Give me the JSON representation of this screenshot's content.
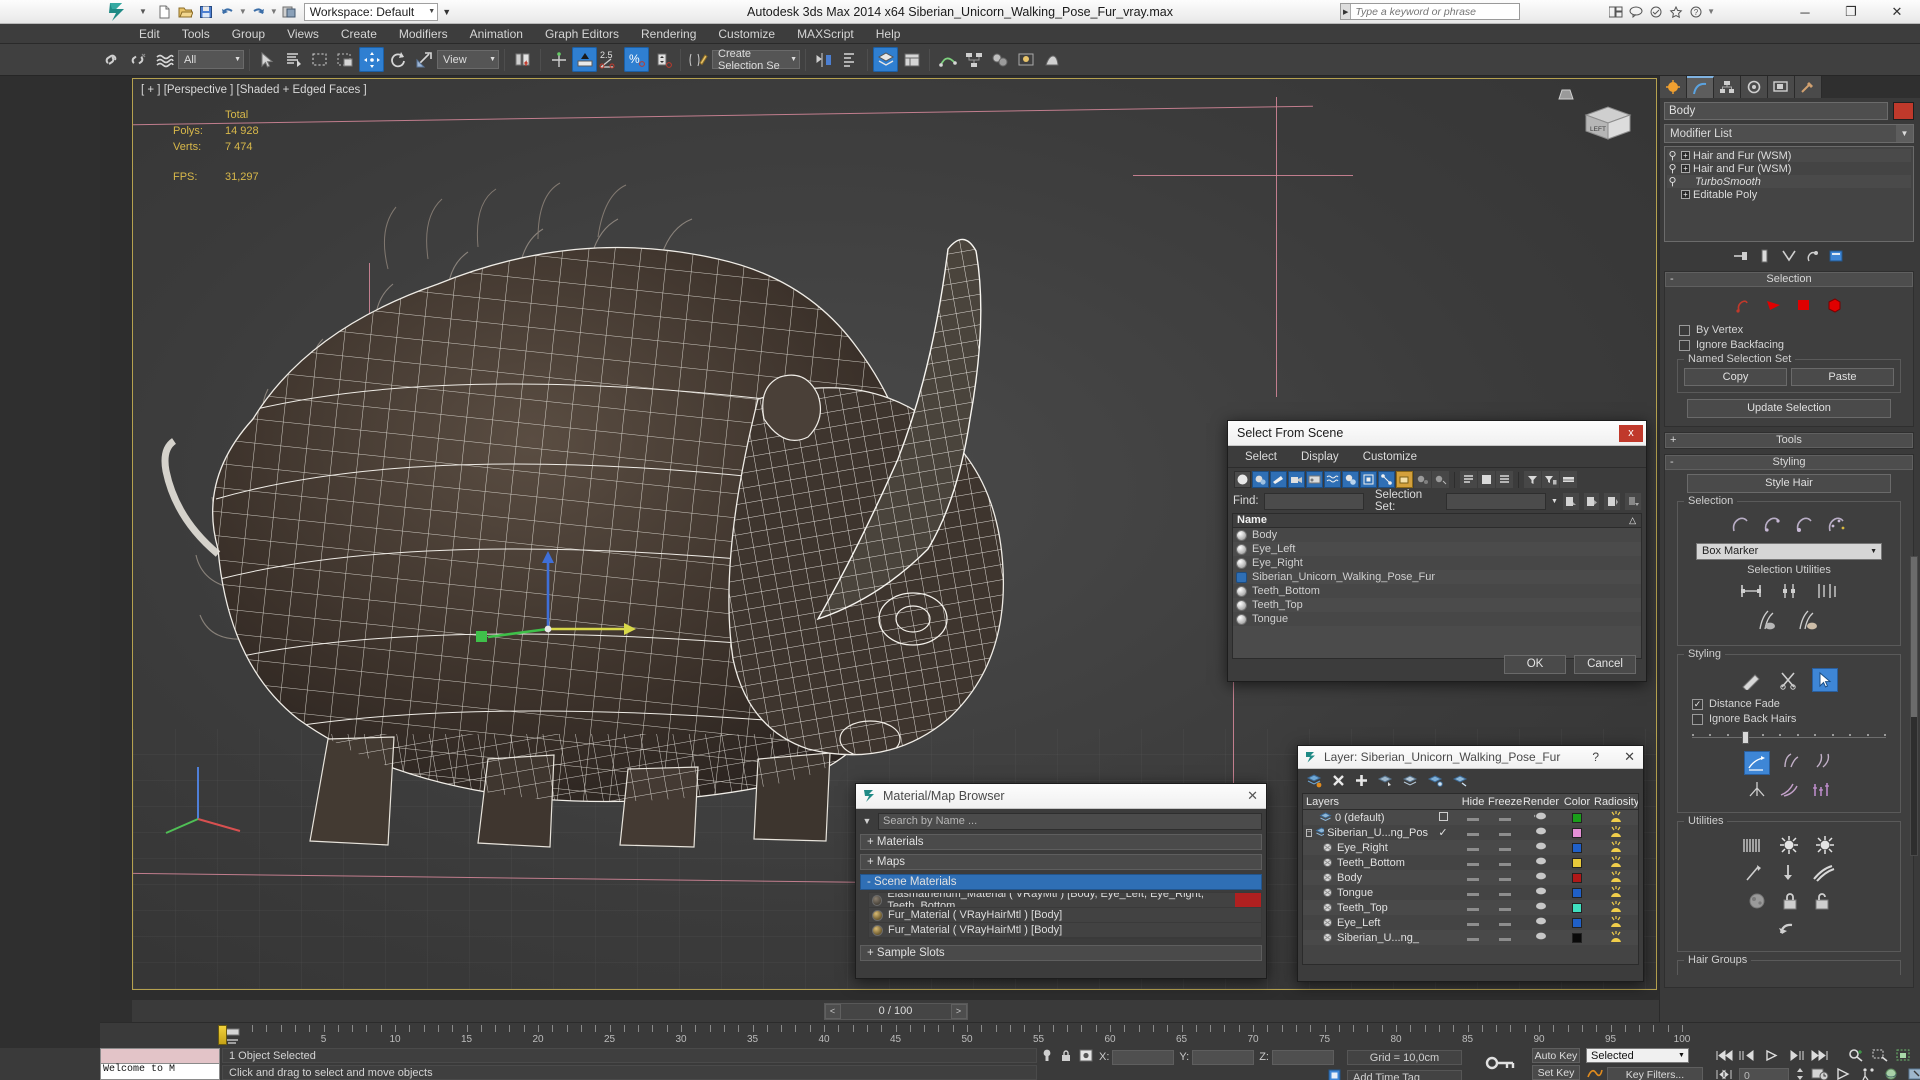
{
  "titlebar": {
    "workspace": "Workspace: Default",
    "app_title": "Autodesk 3ds Max  2014 x64     Siberian_Unicorn_Walking_Pose_Fur_vray.max",
    "search_placeholder": "Type a keyword or phrase",
    "minimize": "─",
    "maximize": "❐",
    "close": "✕",
    "quick_access": [
      "new-file-icon",
      "open-file-icon",
      "save-file-icon",
      "undo-icon",
      "redo-icon",
      "set-project-icon"
    ]
  },
  "menu": {
    "items": [
      "Edit",
      "Tools",
      "Group",
      "Views",
      "Create",
      "Modifiers",
      "Animation",
      "Graph Editors",
      "Rendering",
      "Customize",
      "MAXScript",
      "Help"
    ]
  },
  "toolbar": {
    "selection_filter": "All",
    "ref_coord_system": "View",
    "named_selection_set": "Create Selection Se",
    "angle_snap_value": "2.5",
    "percent_label": "%"
  },
  "viewport": {
    "label": "[ + ] [Perspective ] [Shaded + Edged Faces ]",
    "stats": {
      "total_header": "Total",
      "polys_label": "Polys:",
      "polys_value": "14 928",
      "verts_label": "Verts:",
      "verts_value": "7 474",
      "fps_label": "FPS:",
      "fps_value": "31,297"
    },
    "viewcube_face": "LEFT"
  },
  "command_panel": {
    "tabs": [
      "create-tab",
      "modify-tab",
      "hierarchy-tab",
      "motion-tab",
      "display-tab",
      "utilities-tab"
    ],
    "active_tab_index": 1,
    "object_name": "Body",
    "object_color": "#c0392b",
    "modifier_list_label": "Modifier List",
    "stack": [
      {
        "label": "Hair and Fur (WSM)",
        "italic": false,
        "expandable": true
      },
      {
        "label": "Hair and Fur (WSM)",
        "italic": false,
        "expandable": true
      },
      {
        "label": "TurboSmooth",
        "italic": true,
        "expandable": false
      },
      {
        "label": "Editable Poly",
        "italic": false,
        "expandable": true
      }
    ],
    "rollouts": {
      "selection": {
        "title": "Selection",
        "state": "-",
        "icons": [
          "guides-icon",
          "strand-icon",
          "hair-card-icon",
          "hair-volume-icon"
        ],
        "by_vertex": "By Vertex",
        "ignore_backfacing": "Ignore Backfacing",
        "named_selection_set_group": "Named Selection Set",
        "copy": "Copy",
        "paste": "Paste",
        "update_selection": "Update Selection"
      },
      "tools": {
        "title": "Tools",
        "state": "+"
      },
      "styling": {
        "title": "Styling",
        "state": "-",
        "style_hair": "Style Hair",
        "selection_group": "Selection",
        "marker_mode": "Box Marker",
        "selection_utilities": "Selection Utilities",
        "styling_group": "Styling",
        "distance_fade": "Distance Fade",
        "ignore_back_hairs": "Ignore Back Hairs"
      },
      "utilities": {
        "title": "Utilities"
      },
      "hair_groups": {
        "title": "Hair Groups"
      }
    }
  },
  "select_from_scene": {
    "title": "Select From Scene",
    "close": "x",
    "menu": [
      "Select",
      "Display",
      "Customize"
    ],
    "find_label": "Find:",
    "find_value": "",
    "selection_set_label": "Selection Set:",
    "selection_set_value": "",
    "column_header": "Name",
    "sort_marker": "△",
    "rows": [
      {
        "name": "Body",
        "type": "object"
      },
      {
        "name": "Eye_Left",
        "type": "object"
      },
      {
        "name": "Eye_Right",
        "type": "object"
      },
      {
        "name": "Siberian_Unicorn_Walking_Pose_Fur",
        "type": "group"
      },
      {
        "name": "Teeth_Bottom",
        "type": "object"
      },
      {
        "name": "Teeth_Top",
        "type": "object"
      },
      {
        "name": "Tongue",
        "type": "object"
      }
    ],
    "ok": "OK",
    "cancel": "Cancel"
  },
  "material_browser": {
    "title": "Material/Map Browser",
    "close": "✕",
    "search_placeholder": "Search by Name ...",
    "sections": [
      {
        "label": "+ Materials",
        "open": false
      },
      {
        "label": "+ Maps",
        "open": false
      },
      {
        "label": "-  Scene Materials",
        "open": true
      }
    ],
    "scene_materials": [
      {
        "name": "Elasmatherium_Material  ( VRayMtl )  [Body, Eye_Left, Eye_Right, Teeth_Bottom,...",
        "swatch": "dark"
      },
      {
        "name": "Fur_Material  ( VRayHairMtl )  [Body]",
        "swatch": "gold"
      },
      {
        "name": "Fur_Material  ( VRayHairMtl )  [Body]",
        "swatch": "gold"
      }
    ],
    "footer_section": "+ Sample Slots"
  },
  "layer_dialog": {
    "title": "Layer: Siberian_Unicorn_Walking_Pose_Fur",
    "help": "?",
    "close": "✕",
    "toolbar_icons": [
      "create-new-layer-icon",
      "delete-layer-icon",
      "add-to-layer-icon",
      "select-objects-in-layer-icon",
      "select-highlighted-objects-icon",
      "highlight-selected-objects-icon",
      "hide-unhide-layers-icon"
    ],
    "columns": [
      "Layers",
      "",
      "Hide",
      "Freeze",
      "Render",
      "Color",
      "Radiosity"
    ],
    "rows": [
      {
        "name": "0 (default)",
        "kind": "layer",
        "checkbox": "box",
        "color": "#1a9e1a"
      },
      {
        "name": "Siberian_U...ng_Pos",
        "kind": "layer",
        "checkbox": "check",
        "color": "#e58fd6"
      },
      {
        "name": "Eye_Right",
        "kind": "object",
        "checkbox": "",
        "color": "#2060c8"
      },
      {
        "name": "Teeth_Bottom",
        "kind": "object",
        "checkbox": "",
        "color": "#e8c93a"
      },
      {
        "name": "Body",
        "kind": "object",
        "checkbox": "",
        "color": "#b01818"
      },
      {
        "name": "Tongue",
        "kind": "object",
        "checkbox": "",
        "color": "#2060c8"
      },
      {
        "name": "Teeth_Top",
        "kind": "object",
        "checkbox": "",
        "color": "#3fe0c0"
      },
      {
        "name": "Eye_Left",
        "kind": "object",
        "checkbox": "",
        "color": "#2060c8"
      },
      {
        "name": "Siberian_U...ng_",
        "kind": "object",
        "checkbox": "",
        "color": "#0a0a0a"
      }
    ]
  },
  "time_slider": {
    "value": "0 / 100",
    "prev": "<",
    "next": ">"
  },
  "track_bar": {
    "ticks": [
      5,
      10,
      15,
      20,
      25,
      30,
      35,
      40,
      45,
      50,
      55,
      60,
      65,
      70,
      75,
      80,
      85,
      90,
      95,
      100
    ]
  },
  "status_bar": {
    "listener_text": "Welcome to M",
    "selection_status": "1 Object Selected",
    "prompt": "Click and drag to select and move objects",
    "x_label": "X:",
    "x_value": "",
    "y_label": "Y:",
    "y_value": "",
    "z_label": "Z:",
    "z_value": "",
    "grid": "Grid = 10,0cm",
    "add_time_tag": "Add Time Tag",
    "auto_key": "Auto Key",
    "set_key": "Set Key",
    "key_mode": "Selected",
    "key_filters": "Key Filters...",
    "current_frame": "0"
  }
}
